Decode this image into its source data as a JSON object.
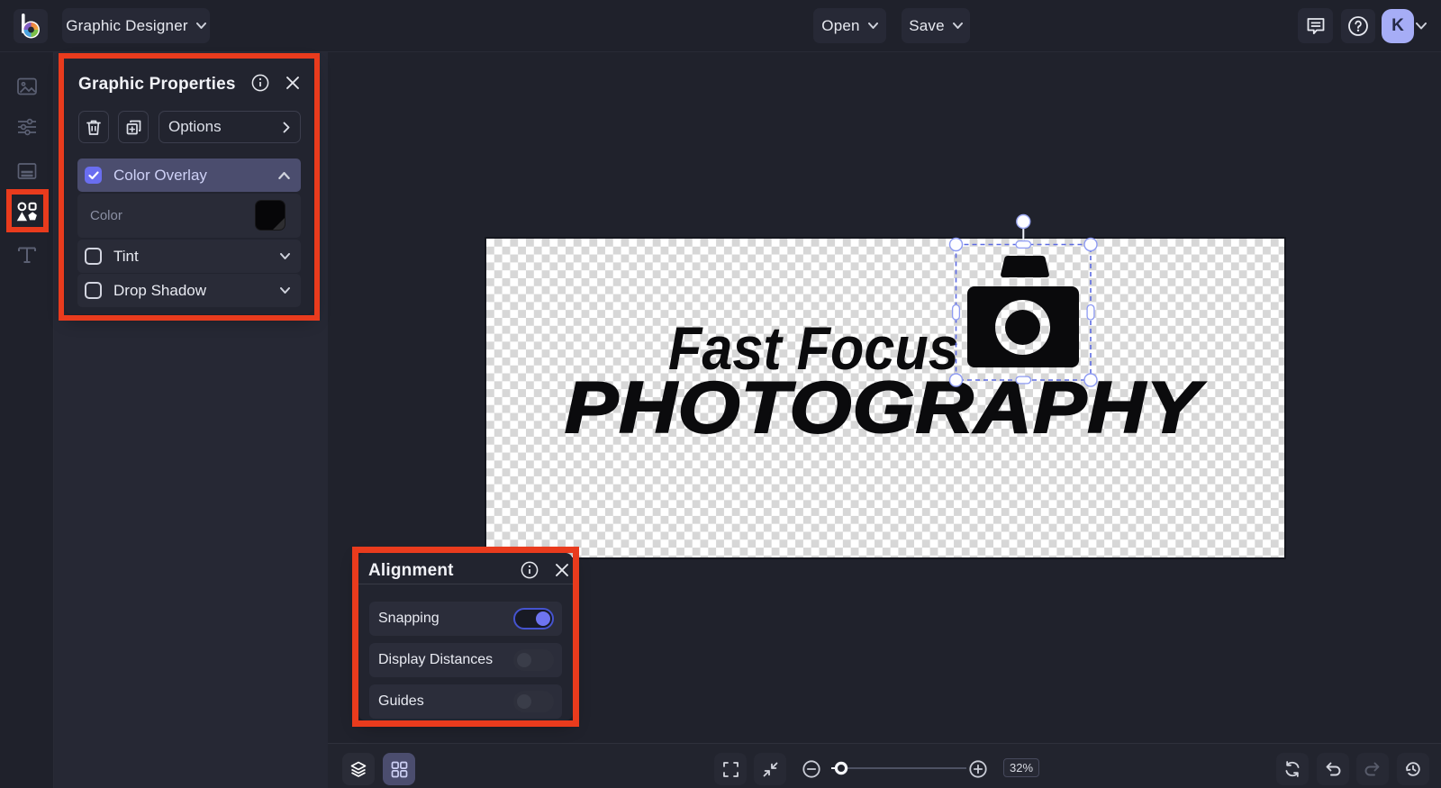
{
  "topbar": {
    "app_menu_label": "Graphic Designer",
    "open_label": "Open",
    "save_label": "Save",
    "avatar_initial": "K"
  },
  "sidebar": {
    "items": [
      {
        "icon": "image-icon",
        "active": false
      },
      {
        "icon": "adjust-sliders-icon",
        "active": false
      },
      {
        "icon": "templates-icon",
        "active": false
      },
      {
        "icon": "graphics-shapes-icon",
        "active": true
      },
      {
        "icon": "text-icon",
        "active": false
      }
    ]
  },
  "graphic_properties_panel": {
    "title": "Graphic Properties",
    "options_label": "Options",
    "rows": {
      "color_overlay": {
        "label": "Color Overlay",
        "checked": true,
        "expanded": true
      },
      "color": {
        "label": "Color",
        "value": "#000000"
      },
      "tint": {
        "label": "Tint",
        "checked": false,
        "expanded": false
      },
      "drop_shadow": {
        "label": "Drop Shadow",
        "checked": false,
        "expanded": false
      }
    }
  },
  "alignment_panel": {
    "title": "Alignment",
    "toggles": [
      {
        "label": "Snapping",
        "on": true
      },
      {
        "label": "Display Distances",
        "on": false
      },
      {
        "label": "Guides",
        "on": false
      }
    ]
  },
  "canvas": {
    "logo_line1": "Fast Focus",
    "logo_line2": "PHOTOGRAPHY"
  },
  "bottom_toolbar": {
    "zoom_value": "32%"
  },
  "colors": {
    "accent": "#6c70f1",
    "annotation_red": "#e93b1d",
    "panel_bg": "#22242f",
    "overlay_row_bg": "#4b4d6e",
    "avatar_bg": "#a6adf6"
  }
}
